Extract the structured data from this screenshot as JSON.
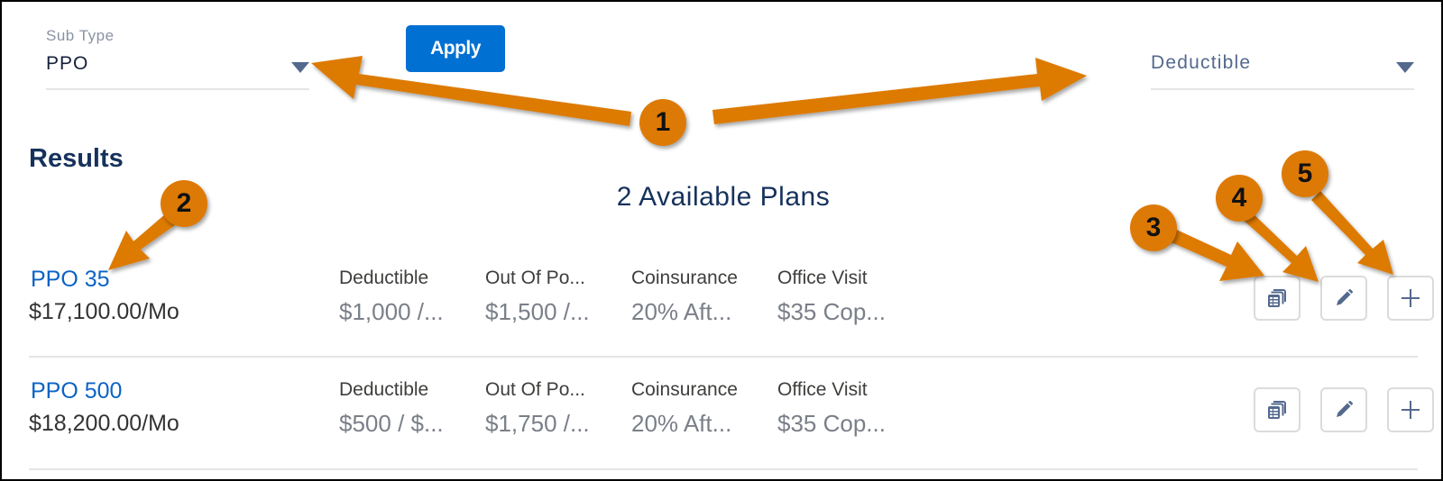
{
  "filters": {
    "sub_type": {
      "label": "Sub Type",
      "value": "PPO"
    },
    "sort_by": {
      "value": "Deductible"
    },
    "apply_label": "Apply"
  },
  "results": {
    "title": "Results",
    "count_text": "2 Available Plans",
    "plans": [
      {
        "name": "PPO 35",
        "price": "$17,100.00/Mo",
        "attributes": [
          {
            "label": "Deductible",
            "value": "$1,000 /..."
          },
          {
            "label": "Out Of Po...",
            "value": "$1,500 /..."
          },
          {
            "label": "Coinsurance",
            "value": "20% Aft..."
          },
          {
            "label": "Office Visit",
            "value": "$35 Cop..."
          }
        ],
        "actions": [
          "compare-icon",
          "edit-icon",
          "add-icon"
        ]
      },
      {
        "name": "PPO 500",
        "price": "$18,200.00/Mo",
        "attributes": [
          {
            "label": "Deductible",
            "value": "$500 / $..."
          },
          {
            "label": "Out Of Po...",
            "value": "$1,750 /..."
          },
          {
            "label": "Coinsurance",
            "value": "20% Aft..."
          },
          {
            "label": "Office Visit",
            "value": "$35 Cop..."
          }
        ],
        "actions": [
          "compare-icon",
          "edit-icon",
          "add-icon"
        ]
      }
    ]
  },
  "annotations": {
    "callouts": [
      "1",
      "2",
      "3",
      "4",
      "5"
    ],
    "color": "#dd7a06"
  },
  "colors": {
    "primary_button": "#0070d2",
    "link": "#0b63c6",
    "heading": "#16325c",
    "icon": "#54698d"
  }
}
